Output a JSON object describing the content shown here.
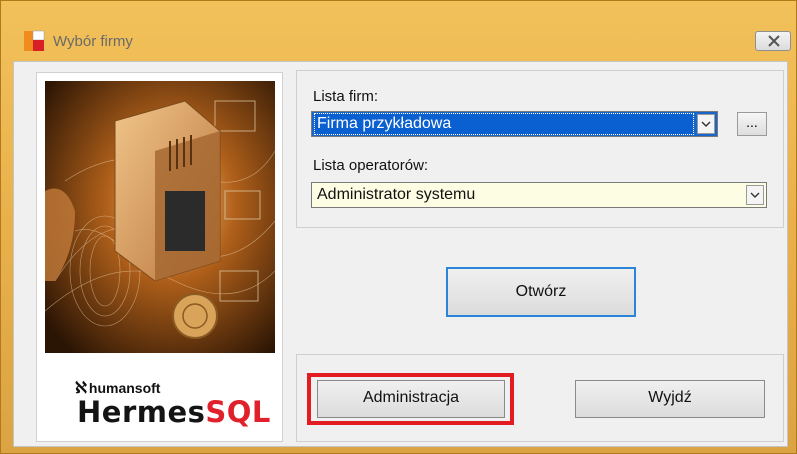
{
  "window": {
    "title": "Wybór firmy"
  },
  "branding": {
    "company": "humansoft",
    "product_part1": "Hermes",
    "product_part2": "SQL"
  },
  "form": {
    "firm_list_label": "Lista firm:",
    "firm_selected": "Firma przykładowa",
    "browse_label": "...",
    "operator_list_label": "Lista operatorów:",
    "operator_selected": "Administrator systemu"
  },
  "buttons": {
    "open": "Otwórz",
    "admin": "Administracja",
    "exit": "Wyjdź"
  },
  "colors": {
    "highlight": "#e31b23",
    "selection": "#0a5fd1",
    "focus_border": "#2a85d8"
  }
}
